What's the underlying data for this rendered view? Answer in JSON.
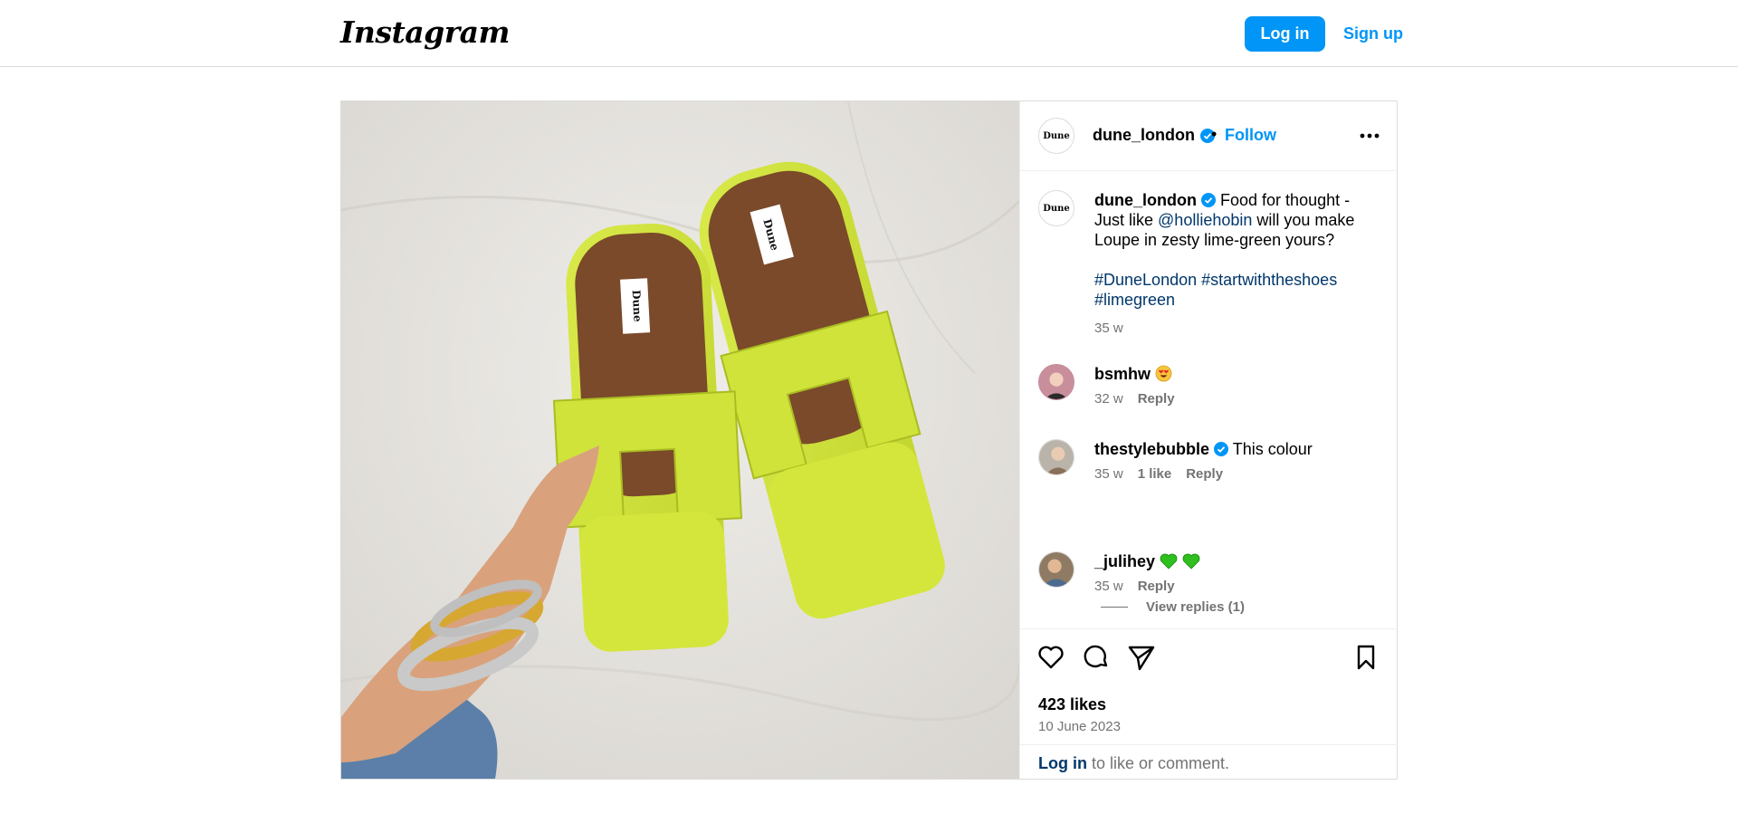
{
  "header": {
    "logo": "Instagram",
    "login_label": "Log in",
    "signup_label": "Sign up"
  },
  "post": {
    "username": "dune_london",
    "avatar_text": "Dune",
    "separator": "•",
    "follow_label": "Follow",
    "photo_label": "Dune",
    "caption": {
      "username": "dune_london",
      "text_before": "Food for thought - Just like ",
      "mention": "@holliehobin",
      "text_after": " will you make Loupe in zesty lime-green yours?",
      "hashtags": "#DuneLondon #startwiththeshoes #limegreen",
      "time": "35 w"
    },
    "comments": [
      {
        "username": "bsmhw",
        "text": "",
        "emoji": "heart-eyes-emoji",
        "time": "32 w",
        "likes": "",
        "reply": "Reply"
      },
      {
        "username": "thestylebubble",
        "text": "This colour",
        "time": "35 w",
        "likes": "1 like",
        "reply": "Reply"
      },
      {
        "username": "_julihey",
        "text": "",
        "emoji": "green-hearts-emoji",
        "time": "35 w",
        "likes": "",
        "reply": "Reply"
      }
    ],
    "view_replies": "View replies (1)",
    "likes": "423 likes",
    "date": "10 June 2023",
    "login_prompt": {
      "link": "Log in",
      "rest": " to like or comment."
    }
  },
  "colors": {
    "accent": "#0095f6",
    "link": "#00376b",
    "muted": "#737373",
    "border": "#dbdbdb",
    "sandal": "#cfe33a"
  },
  "icons": [
    "verified-badge-icon",
    "more-options-icon",
    "heart-icon",
    "comment-icon",
    "share-icon",
    "bookmark-icon"
  ]
}
